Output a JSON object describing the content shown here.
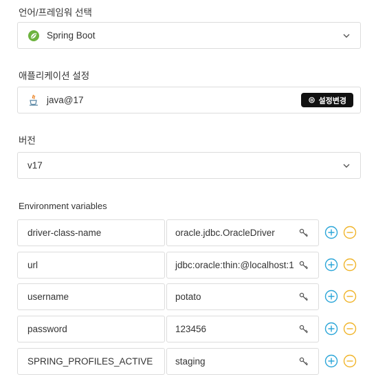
{
  "framework": {
    "label": "언어/프레임워 선택",
    "selected": "Spring Boot",
    "icon": "spring-leaf-icon"
  },
  "app_settings": {
    "label": "애플리케이션 설정",
    "value": "java@17",
    "icon": "java-cup-icon",
    "change_button": "설정변경"
  },
  "version": {
    "label": "버전",
    "selected": "v17"
  },
  "env": {
    "label": "Environment variables",
    "rows": [
      {
        "key": "driver-class-name",
        "value": "oracle.jdbc.OracleDriver"
      },
      {
        "key": "url",
        "value": "jdbc:oracle:thin:@localhost:1"
      },
      {
        "key": "username",
        "value": "potato"
      },
      {
        "key": "password",
        "value": "123456"
      },
      {
        "key": "SPRING_PROFILES_ACTIVE",
        "value": "staging"
      }
    ]
  },
  "colors": {
    "plus": "#2aa5d8",
    "minus": "#f0b429",
    "spring": "#6db33f",
    "button_bg": "#111111"
  }
}
